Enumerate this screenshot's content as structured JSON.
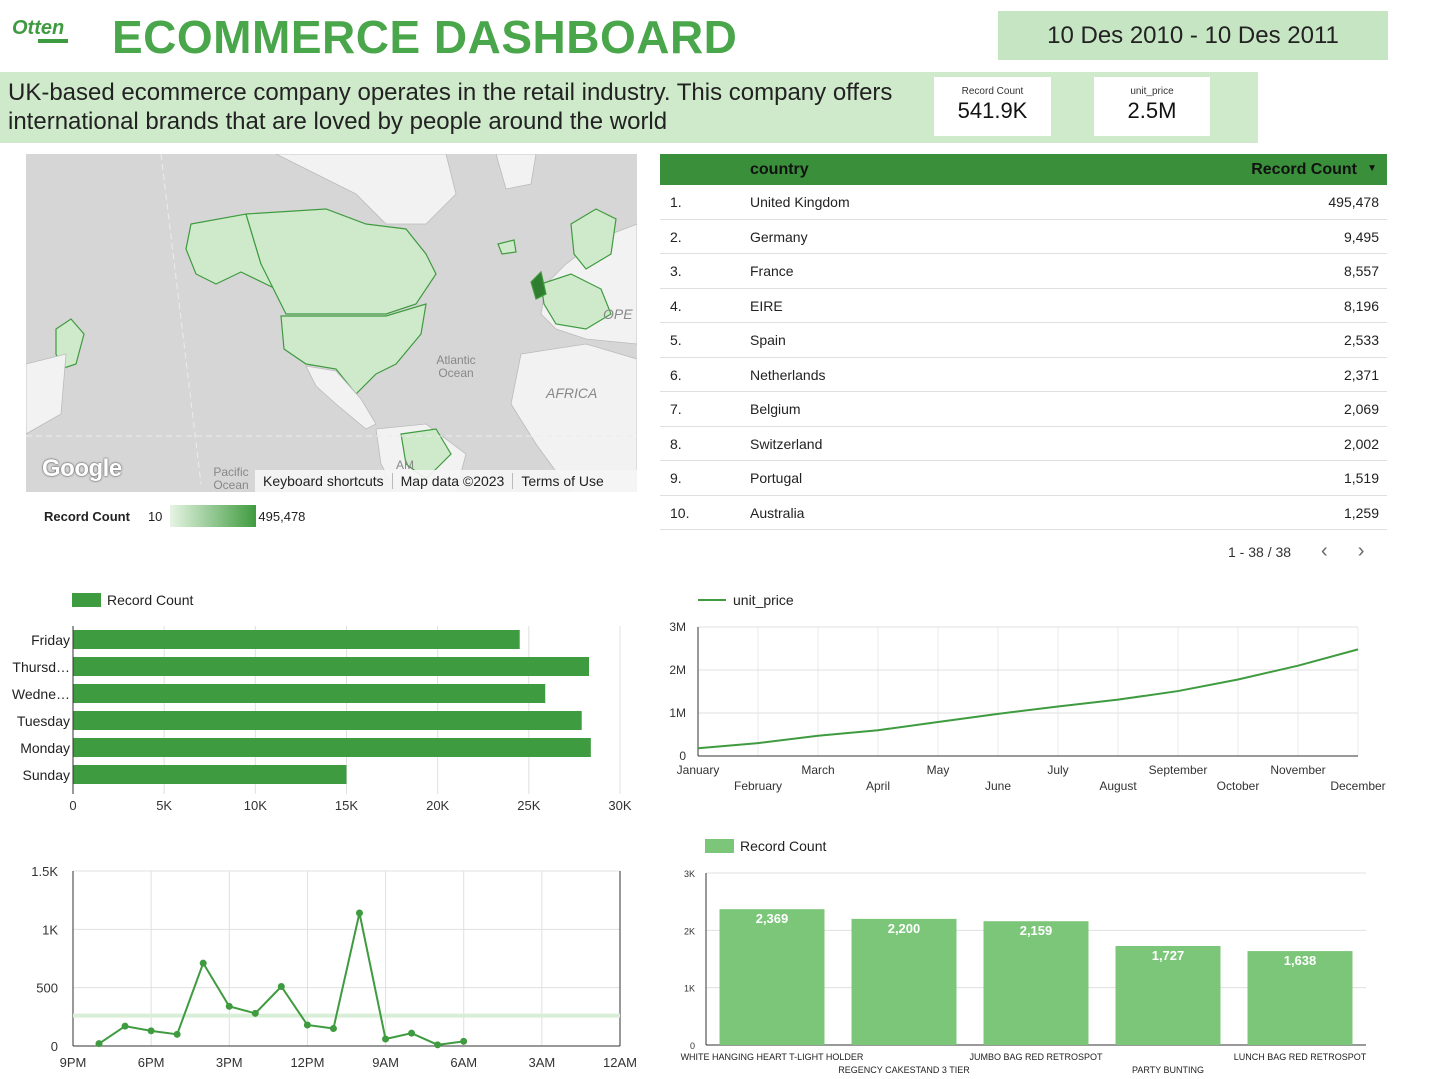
{
  "header": {
    "logo_text": "Otten",
    "title": "ECOMMERCE DASHBOARD",
    "date_range": "10 Des 2010 - 10 Des 2011",
    "description": "UK-based ecommerce company operates in the retail industry. This company offers international brands that are loved by people around the world"
  },
  "scorecards": [
    {
      "label": "Record Count",
      "value": "541.9K"
    },
    {
      "label": "unit_price",
      "value": "2.5M"
    }
  ],
  "map": {
    "labels": {
      "atlantic": "Atlantic\nOcean",
      "africa": "AFRICA",
      "europe": "OPE",
      "pacific": "Pacific\nOcean",
      "am": "AM"
    },
    "google": "Google",
    "footer": [
      "Keyboard shortcuts",
      "Map data ©2023",
      "Terms of Use"
    ],
    "legend": {
      "title": "Record Count",
      "min": "10",
      "max": "495,478"
    }
  },
  "table": {
    "col_country": "country",
    "col_count": "Record Count",
    "sort_icon": "sort-desc-icon",
    "rows": [
      {
        "n": "1.",
        "country": "United Kingdom",
        "count": "495,478"
      },
      {
        "n": "2.",
        "country": "Germany",
        "count": "9,495"
      },
      {
        "n": "3.",
        "country": "France",
        "count": "8,557"
      },
      {
        "n": "4.",
        "country": "EIRE",
        "count": "8,196"
      },
      {
        "n": "5.",
        "country": "Spain",
        "count": "2,533"
      },
      {
        "n": "6.",
        "country": "Netherlands",
        "count": "2,371"
      },
      {
        "n": "7.",
        "country": "Belgium",
        "count": "2,069"
      },
      {
        "n": "8.",
        "country": "Switzerland",
        "count": "2,002"
      },
      {
        "n": "9.",
        "country": "Portugal",
        "count": "1,519"
      },
      {
        "n": "10.",
        "country": "Australia",
        "count": "1,259"
      }
    ],
    "pager": "1 - 38 / 38"
  },
  "colors": {
    "green": "#3f9b3f",
    "light_green": "#7cc67a",
    "header_green": "#4aa64a"
  },
  "chart_data": [
    {
      "type": "bar",
      "orientation": "horizontal",
      "legend": "Record Count",
      "categories": [
        "Friday",
        "Thursd…",
        "Wedne…",
        "Tuesday",
        "Monday",
        "Sunday"
      ],
      "values": [
        24500,
        28300,
        25900,
        27900,
        28400,
        15000
      ],
      "xticks": [
        "0",
        "5K",
        "10K",
        "15K",
        "20K",
        "25K",
        "30K"
      ],
      "xlim": [
        0,
        30000
      ]
    },
    {
      "type": "line",
      "legend": "unit_price",
      "categories": [
        "January",
        "February",
        "March",
        "April",
        "May",
        "June",
        "July",
        "August",
        "September",
        "October",
        "November",
        "December"
      ],
      "values": [
        180000,
        300000,
        470000,
        600000,
        790000,
        980000,
        1150000,
        1310000,
        1510000,
        1780000,
        2100000,
        2480000
      ],
      "yticks": [
        "0",
        "1M",
        "2M",
        "3M"
      ],
      "ylim": [
        0,
        3000000
      ]
    },
    {
      "type": "line",
      "categories": [
        "8PM",
        "7PM",
        "6PM",
        "5PM",
        "4PM",
        "3PM",
        "2PM",
        "1PM",
        "12PM",
        "11AM",
        "10AM",
        "9AM",
        "8AM",
        "7AM",
        "6AM"
      ],
      "values": [
        20,
        170,
        130,
        100,
        710,
        340,
        280,
        510,
        180,
        150,
        1140,
        60,
        110,
        10,
        40
      ],
      "xticks": [
        "9PM",
        "6PM",
        "3PM",
        "12PM",
        "9AM",
        "6AM",
        "3AM",
        "12AM"
      ],
      "yticks": [
        "0",
        "500",
        "1K",
        "1.5K"
      ],
      "ylim": [
        0,
        1500
      ]
    },
    {
      "type": "bar",
      "legend": "Record Count",
      "categories": [
        "WHITE HANGING HEART T-LIGHT HOLDER",
        "REGENCY CAKESTAND 3 TIER",
        "JUMBO BAG RED RETROSPOT",
        "PARTY BUNTING",
        "LUNCH BAG RED RETROSPOT"
      ],
      "values": [
        2369,
        2200,
        2159,
        1727,
        1638
      ],
      "labels": [
        "2,369",
        "2,200",
        "2,159",
        "1,727",
        "1,638"
      ],
      "yticks": [
        "0",
        "1K",
        "2K",
        "3K"
      ],
      "ylim": [
        0,
        3000
      ]
    }
  ]
}
